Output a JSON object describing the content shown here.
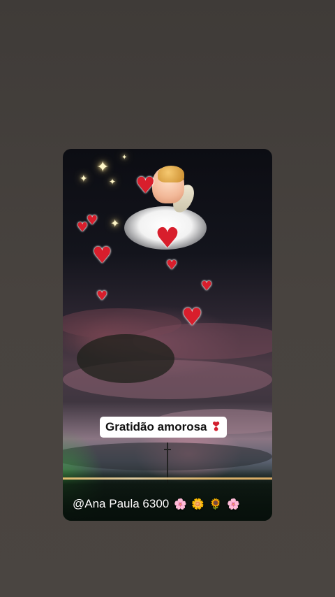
{
  "story": {
    "caption": "Gratidão amorosa",
    "caption_emoji": "❣",
    "watermark": "@Ana Paula 6300",
    "watermark_emojis": [
      "🌸",
      "🌼",
      "🌻",
      "🌸"
    ]
  },
  "colors": {
    "page_background": "#46413d",
    "caption_background": "#ffffff",
    "caption_text": "#111111",
    "heart_red": "#d81e2c",
    "watermark_text": "#ffffff"
  },
  "icons": {
    "sparkle": "✦",
    "heart": "♥"
  }
}
